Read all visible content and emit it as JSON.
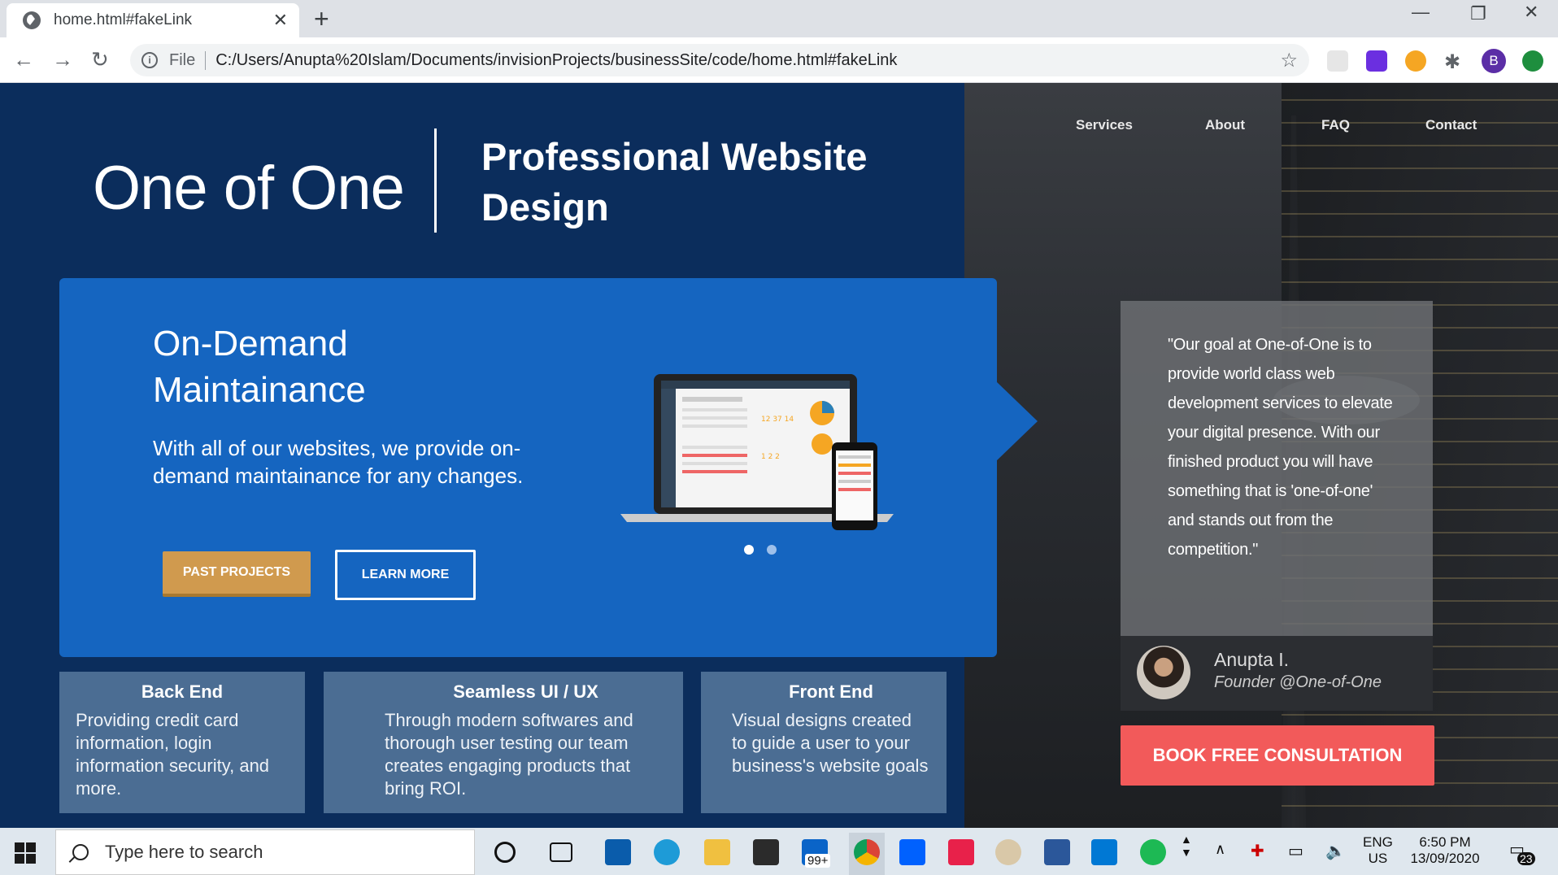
{
  "browser": {
    "tab_title": "home.html#fakeLink",
    "url_scheme_label": "File",
    "url": "C:/Users/Anupta%20Islam/Documents/invisionProjects/businessSite/code/home.html#fakeLink",
    "profile_initial": "B"
  },
  "site": {
    "logo": "One of One",
    "tagline": "Professional Website Design",
    "nav": [
      "Services",
      "About",
      "FAQ",
      "Contact"
    ]
  },
  "hero": {
    "title": "On-Demand Maintainance",
    "body": "With all of our websites, we provide on-demand maintainance for any changes.",
    "btn_past": "PAST PROJECTS",
    "btn_learn": "LEARN MORE",
    "slide_count": 2,
    "active_slide": 1
  },
  "features": [
    {
      "title": "Back End",
      "body": "Providing credit card information, login information security, and more."
    },
    {
      "title": "Seamless UI / UX",
      "body": "Through modern softwares and thorough user testing our team creates engaging products that bring ROI."
    },
    {
      "title": "Front End",
      "body": "Visual designs created to guide a user to your business's website goals"
    }
  ],
  "testimonial": {
    "quote": "\"Our goal at One-of-One is to provide world class web development services to elevate your digital presence. With our finished product you will have something that is 'one-of-one' and stands out from the competition.\"",
    "name": "Anupta I.",
    "role": "Founder @One-of-One",
    "cta": "BOOK FREE CONSULTATION"
  },
  "taskbar": {
    "search_placeholder": "Type here to search",
    "mail_badge": "99+",
    "lang": "ENG",
    "region": "US",
    "time": "6:50 PM",
    "date": "13/09/2020",
    "notif_count": "23"
  },
  "colors": {
    "page_bg": "#0b2d5c",
    "hero_bg": "#1565c0",
    "accent_gold": "#d09a4e",
    "cta_red": "#f25a5a",
    "card_bg": "#4b6d93"
  }
}
